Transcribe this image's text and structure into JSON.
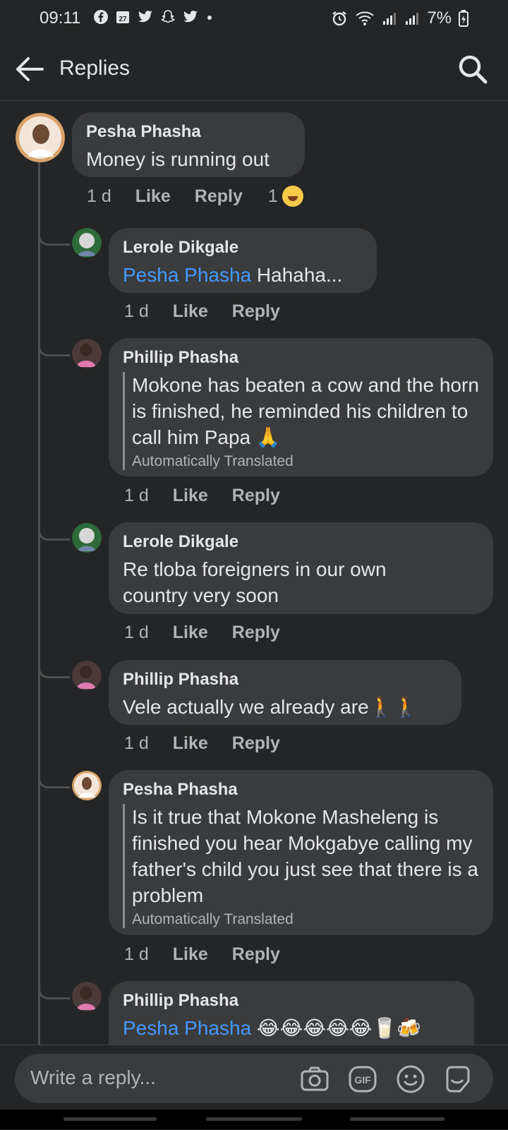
{
  "status_bar": {
    "time": "09:11",
    "notification_icons": [
      "facebook-icon",
      "calendar-icon",
      "twitter-icon",
      "snapchat-icon",
      "twitter-icon",
      "dot-icon"
    ],
    "calendar_date": "27",
    "battery": "7%"
  },
  "header": {
    "title": "Replies"
  },
  "comments": [
    {
      "author": "Pesha Phasha",
      "text": "Money is running out",
      "time": "1 d",
      "like": "Like",
      "reply": "Reply",
      "reaction_count": "1",
      "reaction": "laughing-emoji"
    },
    {
      "author": "Lerole Dikgale",
      "mention": "Pesha Phasha",
      "text": " Hahaha...",
      "time": "1 d",
      "like": "Like",
      "reply": "Reply"
    },
    {
      "author": "Phillip Phasha",
      "text": "Mokone has beaten a cow and the horn is finished, he reminded his children to call him Papa 🙏",
      "translated": "Automatically Translated",
      "time": "1 d",
      "like": "Like",
      "reply": "Reply"
    },
    {
      "author": "Lerole Dikgale",
      "text": "Re tloba foreigners in our own country very soon",
      "time": "1 d",
      "like": "Like",
      "reply": "Reply"
    },
    {
      "author": "Phillip Phasha",
      "text": "Vele actually we already are🚶🚶",
      "time": "1 d",
      "like": "Like",
      "reply": "Reply"
    },
    {
      "author": "Pesha Phasha",
      "text": "Is it true that Mokone Masheleng is finished you hear Mokgabye calling my father's child you just see that there is a problem",
      "translated": "Automatically Translated",
      "time": "1 d",
      "like": "Like",
      "reply": "Reply"
    },
    {
      "author": "Phillip Phasha",
      "mention": "Pesha Phasha",
      "text": " 😂😂😂😂😂🥛🍻"
    }
  ],
  "composer": {
    "placeholder": "Write a reply...",
    "icons": [
      "camera-icon",
      "gif-icon",
      "emoji-icon",
      "sticker-icon"
    ]
  }
}
